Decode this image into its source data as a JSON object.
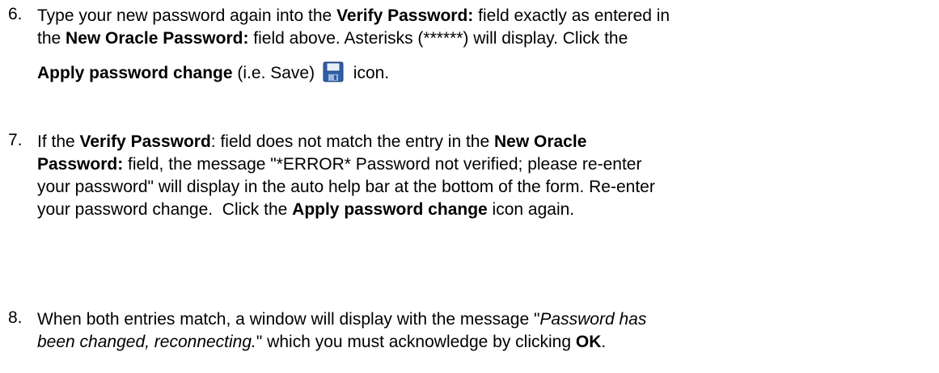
{
  "step6": {
    "number": "6.",
    "l1_a": "Type your new password again into the ",
    "l1_b": "Verify Password:",
    "l1_c": " field exactly as entered in",
    "l2_a": "the ",
    "l2_b": "New Oracle Password:",
    "l2_c": " field above. Asterisks (******) will display. Click the",
    "l3_a": "Apply password change",
    "l3_b": " (i.e. Save) ",
    "l3_c": " icon.",
    "icon": "save-floppy-icon"
  },
  "step7": {
    "number": "7.",
    "l1_a": "If the ",
    "l1_b": "Verify Password",
    "l1_c": ": field does not match the entry in the ",
    "l1_d": "New Oracle",
    "l2_a": "Password:",
    "l2_b": " field, the message \"*ERROR* Password not verified; please re-enter",
    "l3": "your password\" will display in the auto help bar at the bottom of the form. Re-enter",
    "l4_a": "your password change.  Click the ",
    "l4_b": "Apply password change",
    "l4_c": " icon again."
  },
  "step8": {
    "number": "8.",
    "l1_a": "When both entries match, a window will display with the message \"",
    "l1_b": "Password has",
    "l2_a": "been changed, reconnecting.",
    "l2_b": "\" which you must acknowledge by clicking ",
    "l2_c": "OK",
    "l2_d": "."
  },
  "colors": {
    "text": "#000000",
    "icon_body": "#2f5fa8",
    "icon_label": "#e8eef8"
  }
}
